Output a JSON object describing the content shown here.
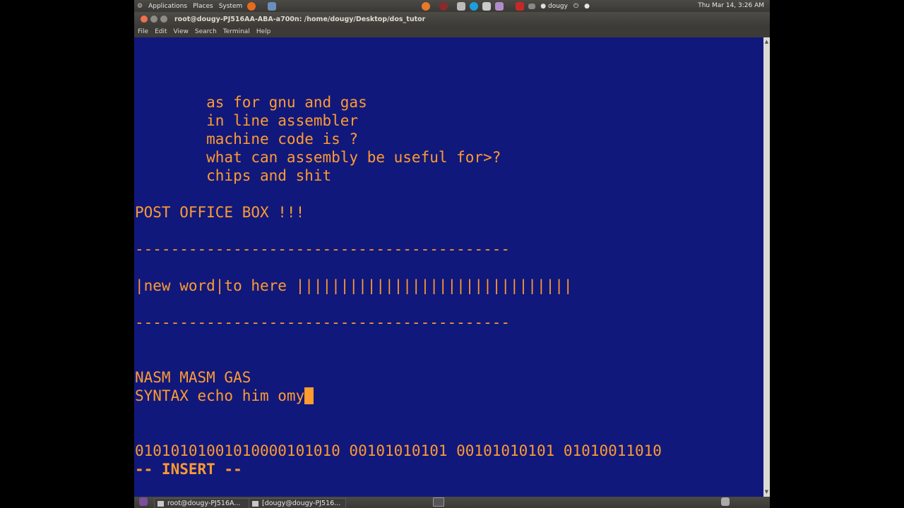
{
  "top_panel": {
    "applications": "Applications",
    "places": "Places",
    "system": "System",
    "user": "dougy",
    "clock": "Thu Mar 14,  3:26 AM"
  },
  "window": {
    "title": "root@dougy-PJ516AA-ABA-a700n: /home/dougy/Desktop/dos_tutor",
    "menu": [
      "File",
      "Edit",
      "View",
      "Search",
      "Terminal",
      "Help"
    ]
  },
  "terminal": {
    "lines": [
      "        as for gnu and gas",
      "        in line assembler",
      "        machine code is ?",
      "        what can assembly be useful for>?",
      "        chips and shit",
      "POST OFFICE BOX !!!",
      "------------------------------------------",
      "|new word|to here |||||||||||||||||||||||||||||||",
      "------------------------------------------",
      "NASM MASM GAS",
      "SYNTAX echo him omy",
      "01010101001010000101010 00101010101 00101010101 01010011010",
      "-- INSERT --"
    ]
  },
  "taskbar": {
    "task1": "root@dougy-PJ516A...",
    "task2": "[dougy@dougy-PJ516..."
  },
  "colors": {
    "terminal_bg": "#11187c",
    "terminal_fg": "#ff9b2f"
  }
}
